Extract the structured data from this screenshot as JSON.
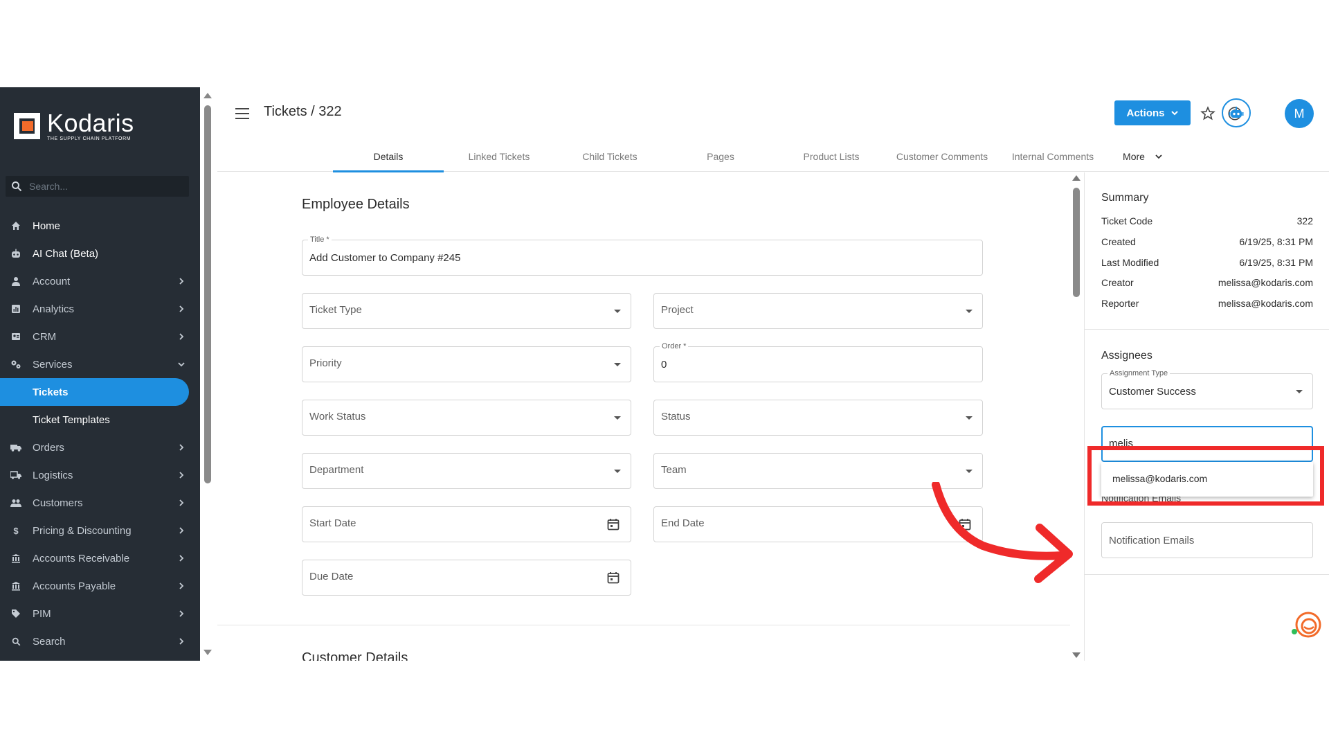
{
  "app": {
    "logo_name": "Kodaris",
    "logo_tagline": "THE SUPPLY CHAIN PLATFORM"
  },
  "sidebar": {
    "search_placeholder": "Search...",
    "items": [
      {
        "label": "Home",
        "icon": "home-icon",
        "chevron": false
      },
      {
        "label": "AI Chat (Beta)",
        "icon": "robot-icon",
        "chevron": false
      },
      {
        "label": "Account",
        "icon": "person-icon",
        "chevron": true
      },
      {
        "label": "Analytics",
        "icon": "chart-icon",
        "chevron": true
      },
      {
        "label": "CRM",
        "icon": "contact-card-icon",
        "chevron": true
      },
      {
        "label": "Services",
        "icon": "gears-icon",
        "chevron": "down"
      },
      {
        "label": "Tickets",
        "sub": true,
        "active": true
      },
      {
        "label": "Ticket Templates",
        "sub": true
      },
      {
        "label": "Orders",
        "icon": "truck-icon",
        "chevron": true
      },
      {
        "label": "Logistics",
        "icon": "shipping-icon",
        "chevron": true
      },
      {
        "label": "Customers",
        "icon": "people-icon",
        "chevron": true
      },
      {
        "label": "Pricing & Discounting",
        "icon": "dollar-icon",
        "chevron": true
      },
      {
        "label": "Accounts Receivable",
        "icon": "bank-icon",
        "chevron": true
      },
      {
        "label": "Accounts Payable",
        "icon": "bank-icon",
        "chevron": true
      },
      {
        "label": "PIM",
        "icon": "tag-icon",
        "chevron": true
      },
      {
        "label": "Search",
        "icon": "search-icon",
        "chevron": true
      }
    ]
  },
  "header": {
    "breadcrumb": "Tickets / 322",
    "actions_label": "Actions",
    "avatar_initial": "M",
    "tabs": [
      "Details",
      "Linked Tickets",
      "Child Tickets",
      "Pages",
      "Product Lists",
      "Customer Comments",
      "Internal Comments"
    ],
    "more_label": "More"
  },
  "form": {
    "section_title": "Employee Details",
    "title_label": "Title *",
    "title_value": "Add Customer to Company #245",
    "ticket_type": "Ticket Type",
    "project": "Project",
    "priority": "Priority",
    "order_label": "Order *",
    "order_value": "0",
    "work_status": "Work Status",
    "status": "Status",
    "department": "Department",
    "team": "Team",
    "start_date": "Start Date",
    "end_date": "End Date",
    "due_date": "Due Date",
    "next_section_title": "Customer Details"
  },
  "summary": {
    "title": "Summary",
    "rows": [
      {
        "label": "Ticket Code",
        "value": "322"
      },
      {
        "label": "Created",
        "value": "6/19/25, 8:31 PM"
      },
      {
        "label": "Last Modified",
        "value": "6/19/25, 8:31 PM"
      },
      {
        "label": "Creator",
        "value": "melissa@kodaris.com"
      },
      {
        "label": "Reporter",
        "value": "melissa@kodaris.com"
      }
    ]
  },
  "assignees": {
    "title": "Assignees",
    "assignment_type_label": "Assignment Type",
    "assignment_type_value": "Customer Success",
    "search_value": "melis",
    "suggestion": "melissa@kodaris.com",
    "notification_label_partial": "Notification Emails",
    "notification_placeholder": "Notification Emails"
  },
  "colors": {
    "accent": "#1e8fe0",
    "sidebar_bg": "#262d35",
    "annotation_red": "#ef2a2a",
    "logo_orange": "#f26b2a"
  }
}
